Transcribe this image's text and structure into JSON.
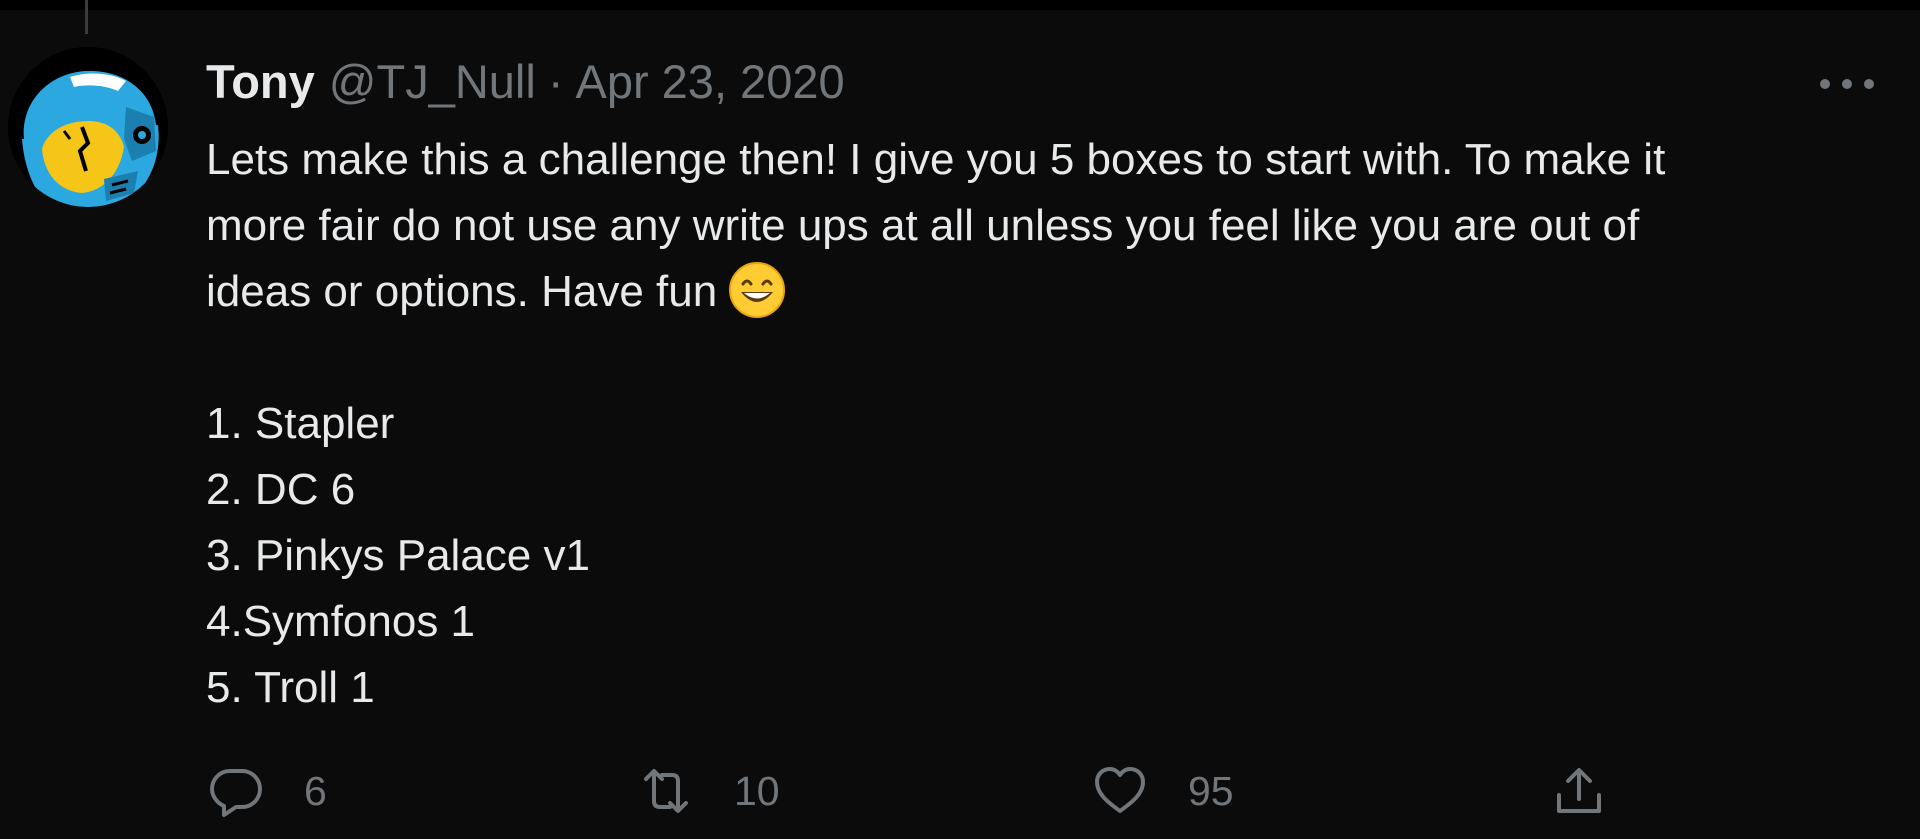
{
  "tweet": {
    "author_name": "Tony",
    "handle": "@TJ_Null",
    "separator": "·",
    "date": "Apr 23, 2020",
    "body_lines": [
      "Lets make this a challenge then! I give you 5 boxes to start with. To make it",
      "more fair do not use any write ups at all unless you feel like you are out of",
      "ideas or options. Have fun"
    ],
    "emoji": "grinning-face-with-smiling-eyes",
    "list": [
      "1. Stapler",
      "2. DC 6",
      "3. Pinkys Palace v1",
      "4.Symfonos 1",
      "5. Troll 1"
    ]
  },
  "actions": {
    "reply": {
      "icon": "reply-icon",
      "count": "6"
    },
    "retweet": {
      "icon": "retweet-icon",
      "count": "10"
    },
    "like": {
      "icon": "heart-icon",
      "count": "95"
    },
    "share": {
      "icon": "share-icon"
    }
  },
  "colors": {
    "background": "#0b0b0b",
    "text": "#e7e9ea",
    "secondary": "#71767b",
    "avatar_blue": "#2ba8e0",
    "avatar_yellow": "#f5c518"
  }
}
